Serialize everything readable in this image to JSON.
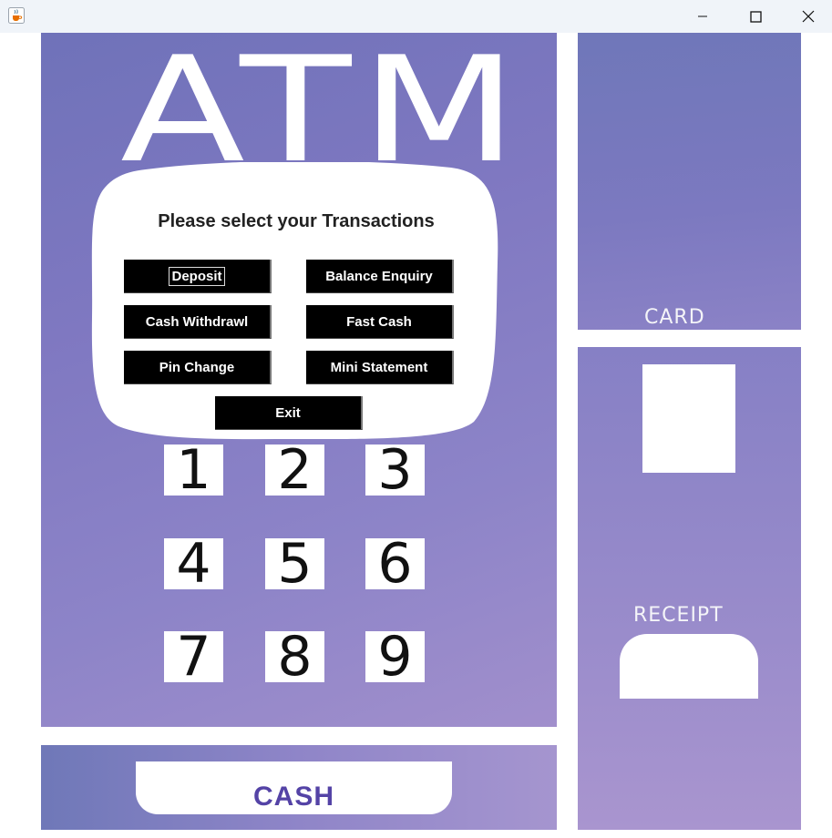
{
  "window": {
    "app_icon": "java-cup-icon",
    "controls": [
      "minimize-icon",
      "maximize-icon",
      "close-icon"
    ]
  },
  "machine": {
    "title": "ATM",
    "prompt": "Please select your Transactions"
  },
  "transactions": {
    "deposit": "Deposit",
    "balance_enquiry": "Balance Enquiry",
    "cash_withdrawl": "Cash Withdrawl",
    "fast_cash": "Fast Cash",
    "pin_change": "Pin Change",
    "mini_statement": "Mini Statement",
    "exit": "Exit"
  },
  "keypad": [
    "1",
    "2",
    "3",
    "4",
    "5",
    "6",
    "7",
    "8",
    "9"
  ],
  "slots": {
    "card": "CARD",
    "receipt": "RECEIPT",
    "cash": "CASH"
  },
  "colors": {
    "panel_purple": "#7f78c1",
    "button_black": "#000000",
    "cash_text": "#5443a6"
  }
}
